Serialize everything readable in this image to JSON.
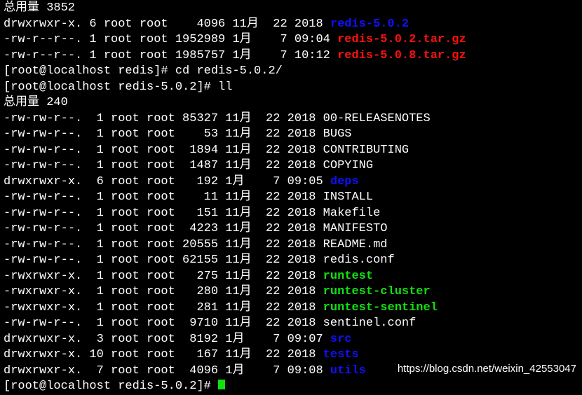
{
  "terminal": {
    "lines": [
      {
        "text": "总用量 3852",
        "name": ""
      },
      {
        "text": "drwxrwxr-x. 6 root root    4096 11月  22 2018 ",
        "name": "redis-5.0.2",
        "kind": "dir"
      },
      {
        "text": "-rw-r--r--. 1 root root 1952989 1月    7 09:04 ",
        "name": "redis-5.0.2.tar.gz",
        "kind": "archive"
      },
      {
        "text": "-rw-r--r--. 1 root root 1985757 1月    7 10:12 ",
        "name": "redis-5.0.8.tar.gz",
        "kind": "archive"
      },
      {
        "text": "[root@localhost redis]# cd redis-5.0.2/",
        "name": ""
      },
      {
        "text": "[root@localhost redis-5.0.2]# ll",
        "name": ""
      },
      {
        "text": "总用量 240",
        "name": ""
      },
      {
        "text": "-rw-rw-r--.  1 root root 85327 11月  22 2018 00-RELEASENOTES",
        "name": ""
      },
      {
        "text": "-rw-rw-r--.  1 root root    53 11月  22 2018 BUGS",
        "name": ""
      },
      {
        "text": "-rw-rw-r--.  1 root root  1894 11月  22 2018 CONTRIBUTING",
        "name": ""
      },
      {
        "text": "-rw-rw-r--.  1 root root  1487 11月  22 2018 COPYING",
        "name": ""
      },
      {
        "text": "drwxrwxr-x.  6 root root   192 1月    7 09:05 ",
        "name": "deps",
        "kind": "dir"
      },
      {
        "text": "-rw-rw-r--.  1 root root    11 11月  22 2018 INSTALL",
        "name": ""
      },
      {
        "text": "-rw-rw-r--.  1 root root   151 11月  22 2018 Makefile",
        "name": ""
      },
      {
        "text": "-rw-rw-r--.  1 root root  4223 11月  22 2018 MANIFESTO",
        "name": ""
      },
      {
        "text": "-rw-rw-r--.  1 root root 20555 11月  22 2018 README.md",
        "name": ""
      },
      {
        "text": "-rw-rw-r--.  1 root root 62155 11月  22 2018 redis.conf",
        "name": ""
      },
      {
        "text": "-rwxrwxr-x.  1 root root   275 11月  22 2018 ",
        "name": "runtest",
        "kind": "exec"
      },
      {
        "text": "-rwxrwxr-x.  1 root root   280 11月  22 2018 ",
        "name": "runtest-cluster",
        "kind": "exec"
      },
      {
        "text": "-rwxrwxr-x.  1 root root   281 11月  22 2018 ",
        "name": "runtest-sentinel",
        "kind": "exec"
      },
      {
        "text": "-rw-rw-r--.  1 root root  9710 11月  22 2018 sentinel.conf",
        "name": ""
      },
      {
        "text": "drwxrwxr-x.  3 root root  8192 1月    7 09:07 ",
        "name": "src",
        "kind": "dir"
      },
      {
        "text": "drwxrwxr-x. 10 root root   167 11月  22 2018 ",
        "name": "tests",
        "kind": "dir"
      },
      {
        "text": "drwxrwxr-x.  7 root root  4096 1月    7 09:08 ",
        "name": "utils",
        "kind": "dir"
      },
      {
        "text": "[root@localhost redis-5.0.2]# ",
        "name": "",
        "cursor": true
      }
    ]
  },
  "watermark": "https://blog.csdn.net/weixin_42553047",
  "colors": {
    "background": "#000000",
    "text": "#ffffff",
    "directory": "#1010ff",
    "archive": "#ff1010",
    "executable": "#10e010"
  }
}
